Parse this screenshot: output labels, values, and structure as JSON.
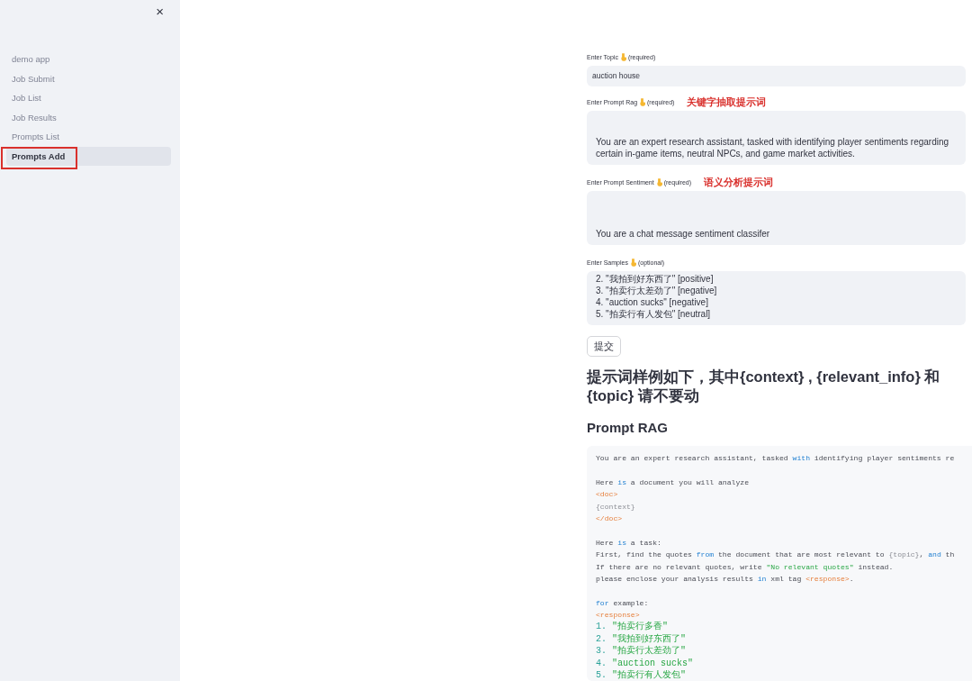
{
  "sidebar": {
    "close": "×",
    "items": [
      {
        "label": "demo app",
        "selected": false,
        "annotated": false
      },
      {
        "label": "Job Submit",
        "selected": false,
        "annotated": false
      },
      {
        "label": "Job List",
        "selected": false,
        "annotated": false
      },
      {
        "label": "Job Results",
        "selected": false,
        "annotated": false
      },
      {
        "label": "Prompts List",
        "selected": false,
        "annotated": false
      },
      {
        "label": "Prompts Add",
        "selected": true,
        "annotated": true
      }
    ]
  },
  "form": {
    "fields": [
      {
        "kind": "input",
        "label": "Enter Topic",
        "hint": "(required)",
        "value": "auction house"
      },
      {
        "kind": "textarea",
        "label": "Enter Prompt Rag",
        "hint": "(required)",
        "annotation": "关键字抽取提示词",
        "value": "You are an expert research assistant, tasked with identifying player sentiments regarding certain in-game items, neutral NPCs, and game market activities."
      },
      {
        "kind": "textarea",
        "label": "Enter Prompt Sentiment",
        "hint": "(required)",
        "annotation": "语义分析提示词",
        "value": "You are a chat message sentiment classifer"
      },
      {
        "kind": "textarea",
        "label": "Enter Samples",
        "hint": "(optional)",
        "value": "2. \"我拍到好东西了\" [positive]\n3. \"拍卖行太差劲了\" [negative]\n4. \"auction sucks\" [negative]\n5. \"拍卖行有人发包\" [neutral]"
      }
    ],
    "submit": "提交"
  },
  "heading": "提示词样例如下，其中{context} , {relevant_info} 和 {topic} 请不要动",
  "subheading": "Prompt RAG",
  "code": [
    {
      "kind": "code",
      "segments": [
        {
          "t": "You are an expert research assistant, tasked ",
          "kind": "plain"
        },
        {
          "t": "with",
          "kind": "keyword"
        },
        {
          "t": " identifying player sentiments re",
          "kind": "plain"
        }
      ]
    },
    {
      "kind": "blank"
    },
    {
      "kind": "code",
      "segments": [
        {
          "t": "Here ",
          "kind": "plain"
        },
        {
          "t": "is",
          "kind": "keyword"
        },
        {
          "t": " a document you will analyze",
          "kind": "plain"
        }
      ]
    },
    {
      "kind": "code",
      "segments": [
        {
          "t": "<doc>",
          "kind": "tag"
        }
      ]
    },
    {
      "kind": "code",
      "segments": [
        {
          "t": "{context}",
          "kind": "brace"
        }
      ]
    },
    {
      "kind": "code",
      "segments": [
        {
          "t": "</doc>",
          "kind": "tag"
        }
      ]
    },
    {
      "kind": "blank"
    },
    {
      "kind": "code",
      "segments": [
        {
          "t": "Here ",
          "kind": "plain"
        },
        {
          "t": "is",
          "kind": "keyword"
        },
        {
          "t": " a task:",
          "kind": "plain"
        }
      ]
    },
    {
      "kind": "code",
      "segments": [
        {
          "t": "First, find the quotes ",
          "kind": "plain"
        },
        {
          "t": "from",
          "kind": "keyword"
        },
        {
          "t": " the document that are most relevant to ",
          "kind": "plain"
        },
        {
          "t": "{topic}",
          "kind": "brace"
        },
        {
          "t": ", ",
          "kind": "plain"
        },
        {
          "t": "and",
          "kind": "keyword"
        },
        {
          "t": " th",
          "kind": "plain"
        }
      ]
    },
    {
      "kind": "code",
      "segments": [
        {
          "t": "If there are no relevant quotes, write ",
          "kind": "plain"
        },
        {
          "t": "\"No relevant quotes\"",
          "kind": "string"
        },
        {
          "t": " instead.",
          "kind": "plain"
        }
      ]
    },
    {
      "kind": "code",
      "segments": [
        {
          "t": "please enclose your analysis results ",
          "kind": "plain"
        },
        {
          "t": "in",
          "kind": "keyword"
        },
        {
          "t": " xml tag ",
          "kind": "plain"
        },
        {
          "t": "<response>",
          "kind": "tag"
        },
        {
          "t": ".",
          "kind": "plain"
        }
      ]
    },
    {
      "kind": "blank"
    },
    {
      "kind": "code",
      "segments": [
        {
          "t": "for",
          "kind": "keyword"
        },
        {
          "t": " example:",
          "kind": "plain"
        }
      ]
    },
    {
      "kind": "code",
      "segments": [
        {
          "t": "<response>",
          "kind": "tag"
        }
      ]
    },
    {
      "kind": "list",
      "segments": [
        {
          "t": "1. ",
          "kind": "number"
        },
        {
          "t": "\"拍卖行多香\"",
          "kind": "string"
        }
      ]
    },
    {
      "kind": "list",
      "segments": [
        {
          "t": "2. ",
          "kind": "number"
        },
        {
          "t": "\"我拍到好东西了\"",
          "kind": "string"
        }
      ]
    },
    {
      "kind": "list",
      "segments": [
        {
          "t": "3. ",
          "kind": "number"
        },
        {
          "t": "\"拍卖行太差劲了\"",
          "kind": "string"
        }
      ]
    },
    {
      "kind": "list",
      "segments": [
        {
          "t": "4. ",
          "kind": "number"
        },
        {
          "t": "\"auction sucks\"",
          "kind": "string"
        }
      ]
    },
    {
      "kind": "list",
      "segments": [
        {
          "t": "5. ",
          "kind": "number"
        },
        {
          "t": "\"拍卖行有人发包\"",
          "kind": "string"
        }
      ]
    }
  ]
}
